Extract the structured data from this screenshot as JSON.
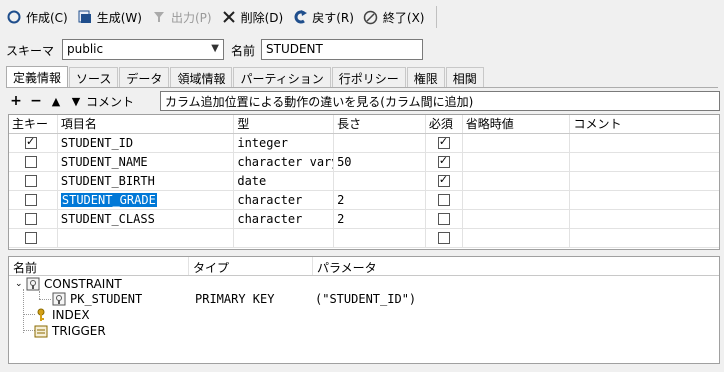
{
  "toolbar": {
    "buttons": [
      {
        "label": "作成(C)",
        "icon": "circle-icon"
      },
      {
        "label": "生成(W)",
        "icon": "generate-icon"
      },
      {
        "label": "出力(P)",
        "icon": "funnel-icon",
        "disabled": true
      },
      {
        "label": "削除(D)",
        "icon": "close-icon"
      },
      {
        "label": "戻す(R)",
        "icon": "undo-icon"
      },
      {
        "label": "終了(X)",
        "icon": "end-icon"
      }
    ]
  },
  "schema": {
    "label": "スキーマ",
    "value": "public"
  },
  "name": {
    "label": "名前",
    "value": "STUDENT"
  },
  "tabs": [
    "定義情報",
    "ソース",
    "データ",
    "領域情報",
    "パーティション",
    "行ポリシー",
    "権限",
    "相関"
  ],
  "column_actions": {
    "comment_label": "コメント",
    "comment_value": "カラム追加位置による動作の違いを見る(カラム間に追加)"
  },
  "grid": {
    "headers": [
      "主キー",
      "項目名",
      "型",
      "長さ",
      "必須",
      "省略時値",
      "コメント"
    ],
    "rows": [
      {
        "pk": true,
        "name": "STUDENT_ID",
        "type": "integer",
        "length": "",
        "required": true,
        "default": "",
        "comment": ""
      },
      {
        "pk": false,
        "name": "STUDENT_NAME",
        "type": "character varying",
        "length": "50",
        "required": true,
        "default": "",
        "comment": ""
      },
      {
        "pk": false,
        "name": "STUDENT_BIRTH",
        "type": "date",
        "length": "",
        "required": true,
        "default": "",
        "comment": ""
      },
      {
        "pk": false,
        "name": "STUDENT_GRADE",
        "type": "character",
        "length": "2",
        "required": false,
        "default": "",
        "comment": "",
        "selected": true
      },
      {
        "pk": false,
        "name": "STUDENT_CLASS",
        "type": "character",
        "length": "2",
        "required": false,
        "default": "",
        "comment": ""
      },
      {
        "pk": false,
        "name": "",
        "type": "",
        "length": "",
        "required": false,
        "default": "",
        "comment": ""
      }
    ]
  },
  "tree": {
    "headers": [
      "名前",
      "タイプ",
      "パラメータ"
    ],
    "constraint": "CONSTRAINT",
    "pk_name": "PK_STUDENT",
    "pk_type": "PRIMARY KEY",
    "pk_param": "(\"STUDENT_ID\")",
    "index": "INDEX",
    "trigger": "TRIGGER"
  },
  "colors": {
    "accent": "#0078d7",
    "toolbar_icon": "#1f4e8c",
    "key_icon": "#d4a017"
  }
}
